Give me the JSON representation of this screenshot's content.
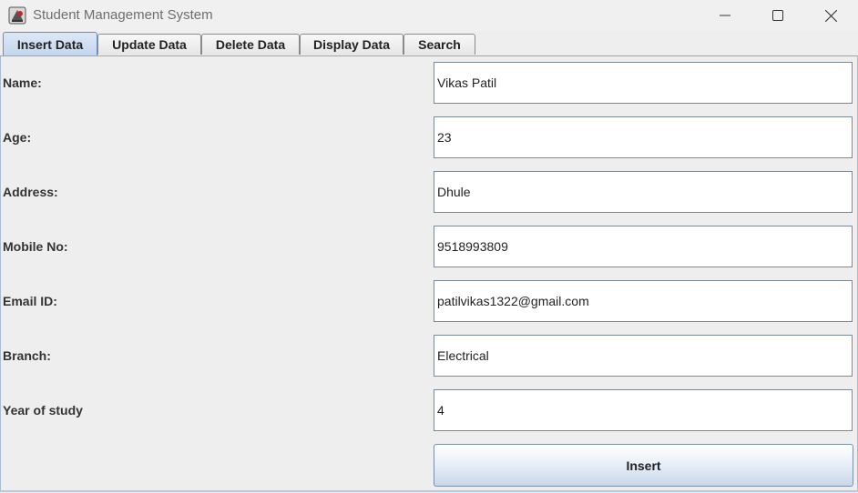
{
  "window": {
    "title": "Student Management System",
    "icons": {
      "app": "java-cup-icon",
      "minimize": "minimize-icon",
      "maximize": "maximize-icon",
      "close": "close-icon"
    }
  },
  "tabs": [
    {
      "label": "Insert Data",
      "active": true
    },
    {
      "label": "Update Data",
      "active": false
    },
    {
      "label": "Delete Data",
      "active": false
    },
    {
      "label": "Display Data",
      "active": false
    },
    {
      "label": "Search",
      "active": false
    }
  ],
  "form": {
    "fields": [
      {
        "label": "Name:",
        "value": "Vikas Patil"
      },
      {
        "label": "Age:",
        "value": "23"
      },
      {
        "label": "Address:",
        "value": "Dhule"
      },
      {
        "label": "Mobile No:",
        "value": "9518993809"
      },
      {
        "label": "Email ID:",
        "value": "patilvikas1322@gmail.com"
      },
      {
        "label": "Branch:",
        "value": "Electrical"
      },
      {
        "label": "Year of study",
        "value": "4"
      }
    ],
    "submit_label": "Insert"
  },
  "colors": {
    "active_tab": "#c3d6ee",
    "panel_background": "#eeeeee",
    "button_gradient_bottom": "#c9d8ea"
  }
}
